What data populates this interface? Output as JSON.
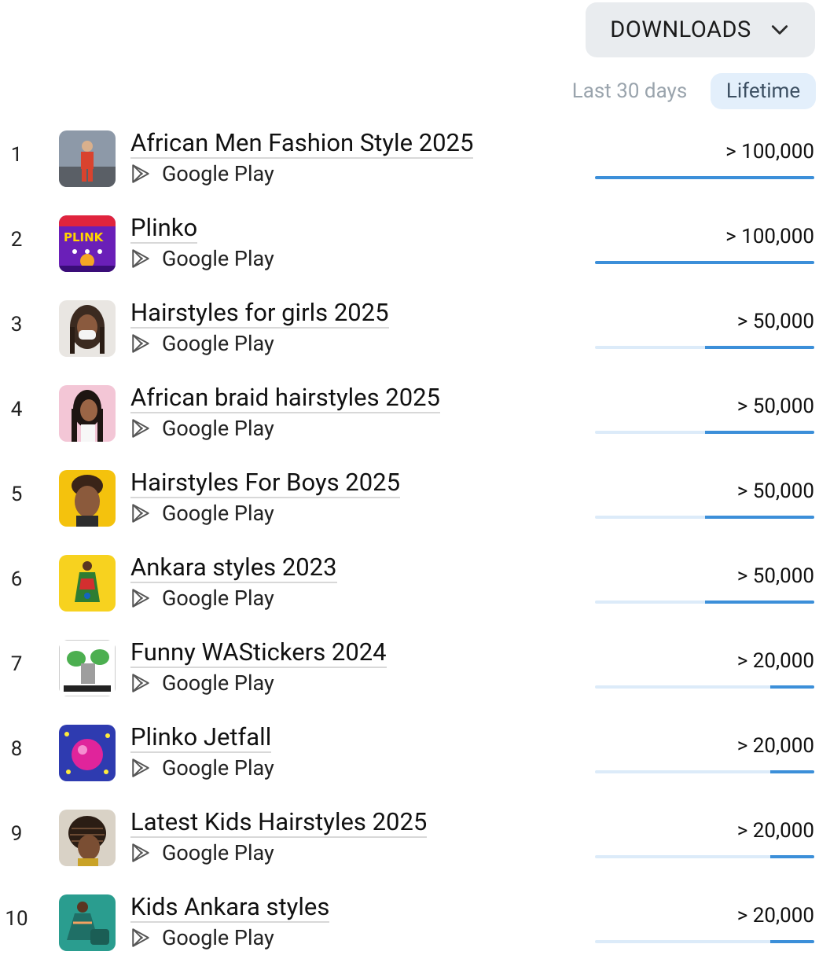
{
  "metric_dropdown": {
    "label": "DOWNLOADS",
    "icon": "chevron-down-icon"
  },
  "period_tabs": [
    {
      "label": "Last 30 days",
      "active": false
    },
    {
      "label": "Lifetime",
      "active": true
    }
  ],
  "colors": {
    "bar_fill": "#3c8fd9",
    "bar_track": "#dcebf9",
    "active_tab_bg": "#e3effb"
  },
  "apps": [
    {
      "rank": "1",
      "title": "African Men Fashion Style 2025",
      "store": "Google Play",
      "downloads": "> 100,000",
      "bar_fraction": 1.0,
      "icon": "african-men-fashion-icon"
    },
    {
      "rank": "2",
      "title": "Plinko",
      "store": "Google Play",
      "downloads": "> 100,000",
      "bar_fraction": 1.0,
      "icon": "plinko-icon"
    },
    {
      "rank": "3",
      "title": "Hairstyles for girls 2025",
      "store": "Google Play",
      "downloads": "> 50,000",
      "bar_fraction": 0.5,
      "icon": "hairstyles-girls-icon"
    },
    {
      "rank": "4",
      "title": "African braid hairstyles 2025",
      "store": "Google Play",
      "downloads": "> 50,000",
      "bar_fraction": 0.5,
      "icon": "african-braid-icon"
    },
    {
      "rank": "5",
      "title": "Hairstyles For Boys 2025",
      "store": "Google Play",
      "downloads": "> 50,000",
      "bar_fraction": 0.5,
      "icon": "hairstyles-boys-icon"
    },
    {
      "rank": "6",
      "title": "Ankara styles 2023",
      "store": "Google Play",
      "downloads": "> 50,000",
      "bar_fraction": 0.5,
      "icon": "ankara-styles-icon"
    },
    {
      "rank": "7",
      "title": "Funny WAStickers 2024",
      "store": "Google Play",
      "downloads": "> 20,000",
      "bar_fraction": 0.2,
      "icon": "funny-stickers-icon"
    },
    {
      "rank": "8",
      "title": "Plinko Jetfall",
      "store": "Google Play",
      "downloads": "> 20,000",
      "bar_fraction": 0.2,
      "icon": "plinko-jetfall-icon"
    },
    {
      "rank": "9",
      "title": "Latest Kids Hairstyles 2025",
      "store": "Google Play",
      "downloads": "> 20,000",
      "bar_fraction": 0.2,
      "icon": "kids-hairstyles-icon"
    },
    {
      "rank": "10",
      "title": "Kids Ankara styles",
      "store": "Google Play",
      "downloads": "> 20,000",
      "bar_fraction": 0.2,
      "icon": "kids-ankara-icon"
    }
  ]
}
